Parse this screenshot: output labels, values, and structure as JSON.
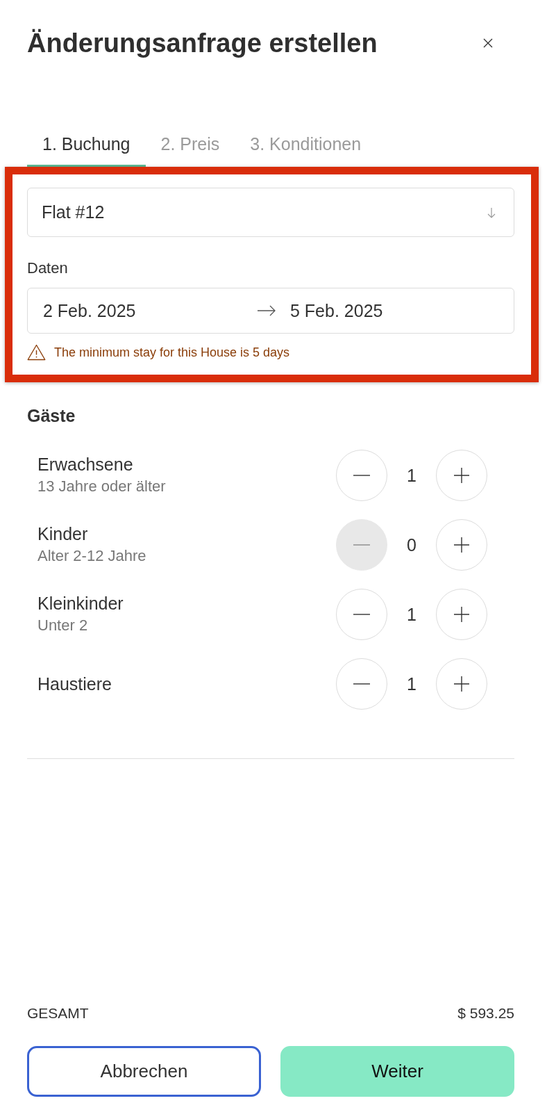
{
  "dialog": {
    "title": "Änderungsanfrage erstellen"
  },
  "tabs": [
    {
      "label": "1. Buchung",
      "selected": true
    },
    {
      "label": "2. Preis",
      "selected": false
    },
    {
      "label": "3. Konditionen",
      "selected": false
    }
  ],
  "booking": {
    "highlighted": true,
    "property": {
      "value": "Flat #12"
    },
    "dates_label": "Daten",
    "dates": {
      "start": "2 Feb. 2025",
      "end": "5 Feb. 2025"
    },
    "warning": "The minimum stay for this House is 5 days"
  },
  "guests": {
    "title": "Gäste",
    "rows": [
      {
        "label": "Erwachsene",
        "hint": "13 Jahre oder älter",
        "count": "1",
        "decrease_disabled": false
      },
      {
        "label": "Kinder",
        "hint": "Alter 2-12 Jahre",
        "count": "0",
        "decrease_disabled": true
      },
      {
        "label": "Kleinkinder",
        "hint": "Unter 2",
        "count": "1",
        "decrease_disabled": false
      },
      {
        "label": "Haustiere",
        "count": "1",
        "decrease_disabled": false
      }
    ]
  },
  "total": {
    "label": "GESAMT",
    "amount": "$ 593.25"
  },
  "buttons": [
    {
      "label": "Abbrechen",
      "kind": "secondary",
      "focused": true
    },
    {
      "label": "Weiter",
      "kind": "primary",
      "focused": false
    }
  ]
}
